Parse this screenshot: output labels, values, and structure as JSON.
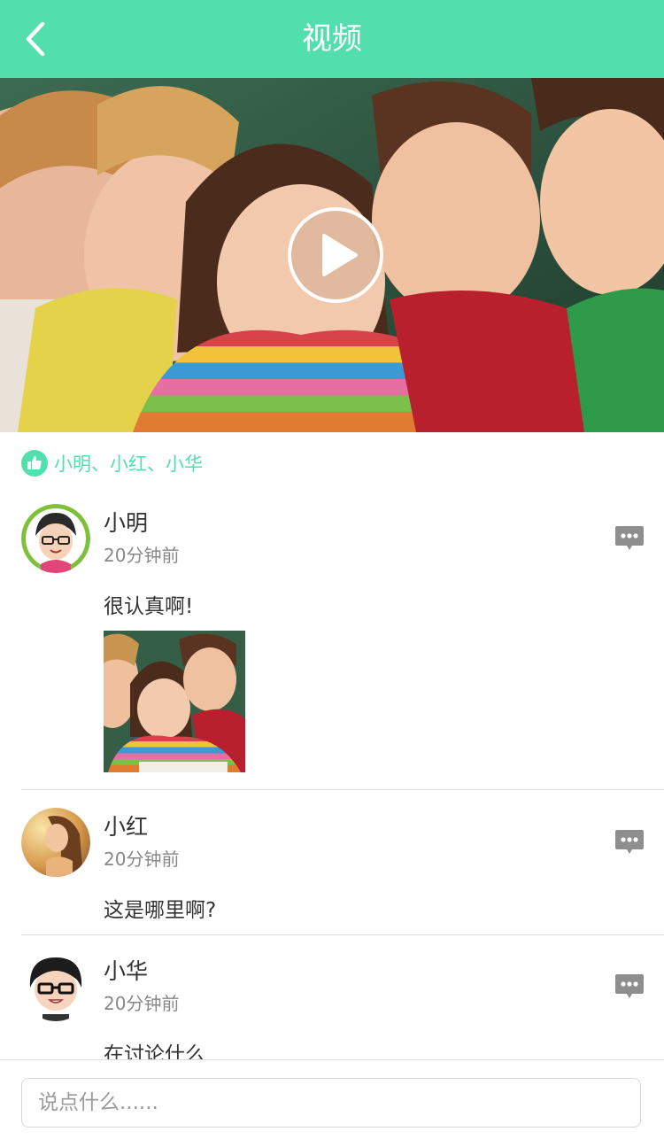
{
  "header": {
    "title": "视频",
    "back_icon": "chevron-left-icon"
  },
  "video": {
    "play_icon": "play-icon"
  },
  "likes": {
    "icon": "thumbs-up-icon",
    "names": "小明、小红、小华"
  },
  "comments": [
    {
      "name": "小明",
      "time": "20分钟前",
      "text": "很认真啊!",
      "has_image": true,
      "reply_icon": "comment-bubble-icon"
    },
    {
      "name": "小红",
      "time": "20分钟前",
      "text": "这是哪里啊?",
      "has_image": false,
      "reply_icon": "comment-bubble-icon"
    },
    {
      "name": "小华",
      "time": "20分钟前",
      "text": "在讨论什么",
      "has_image": false,
      "reply_icon": "comment-bubble-icon"
    }
  ],
  "input": {
    "placeholder": "说点什么......"
  },
  "colors": {
    "accent": "#52dfac",
    "text": "#333333",
    "muted": "#888888",
    "divider": "#dddddd"
  }
}
